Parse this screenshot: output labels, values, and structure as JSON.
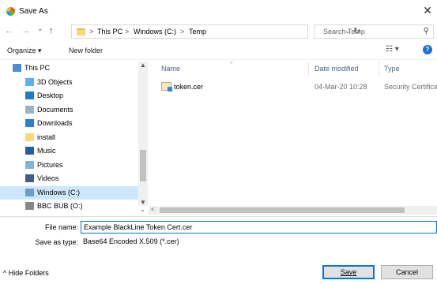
{
  "window": {
    "title": "Save As",
    "close_glyph": "✕"
  },
  "nav_buttons": {
    "back": "←",
    "forward": "→",
    "recent": "⌄",
    "up": "↑"
  },
  "address": {
    "crumbs": [
      "This PC",
      "Windows (C:)",
      "Temp"
    ],
    "separator": ">",
    "dropdown_glyph": "⌄",
    "refresh_glyph": "↻"
  },
  "search": {
    "placeholder": "Search Temp",
    "icon": "search-icon",
    "glyph": "⚲"
  },
  "toolbar": {
    "organize_label": "Organize ▾",
    "new_folder_label": "New folder",
    "view_glyph": "☷ ▾",
    "help_glyph": "?"
  },
  "nav_pane": {
    "items": [
      {
        "label": "This PC",
        "icon": "computer-icon",
        "color": "#4a8fd6",
        "indent": 1
      },
      {
        "label": "3D Objects",
        "icon": "cube-icon",
        "color": "#57b3f0",
        "indent": 2
      },
      {
        "label": "Desktop",
        "icon": "desktop-icon",
        "color": "#1c7ccc",
        "indent": 2
      },
      {
        "label": "Documents",
        "icon": "document-icon",
        "color": "#9fb3c8",
        "indent": 2
      },
      {
        "label": "Downloads",
        "icon": "download-icon",
        "color": "#2a7fd1",
        "indent": 2
      },
      {
        "label": "install",
        "icon": "folder-icon",
        "color": "#f8d775",
        "indent": 2
      },
      {
        "label": "Music",
        "icon": "music-icon",
        "color": "#1f5fa8",
        "indent": 2
      },
      {
        "label": "Pictures",
        "icon": "pictures-icon",
        "color": "#7fb3dd",
        "indent": 2
      },
      {
        "label": "Videos",
        "icon": "video-icon",
        "color": "#3a5f8a",
        "indent": 2
      },
      {
        "label": "Windows (C:)",
        "icon": "drive-icon",
        "color": "#6c9ec9",
        "indent": 2,
        "selected": true
      },
      {
        "label": "BBC BUB (O:)",
        "icon": "drive-icon",
        "color": "#888888",
        "indent": 2
      }
    ]
  },
  "file_list": {
    "columns": [
      "Name",
      "Date modified",
      "Type"
    ],
    "rows": [
      {
        "name": "token.cer",
        "date": "04-Mar-20 10:28",
        "type": "Security Certifica"
      }
    ]
  },
  "form": {
    "filename_label": "File name:",
    "filename_value": "Example BlackLine Token Cert.cer",
    "savetype_label": "Save as type:",
    "savetype_value": "Base64 Encoded X.509 (*.cer)",
    "hide_folders_label": "^ Hide Folders",
    "save_label": "Save",
    "cancel_label": "Cancel"
  },
  "colors": {
    "selected_bg": "#cce8ff",
    "accent": "#0078d7",
    "header_text": "#4d6082"
  }
}
